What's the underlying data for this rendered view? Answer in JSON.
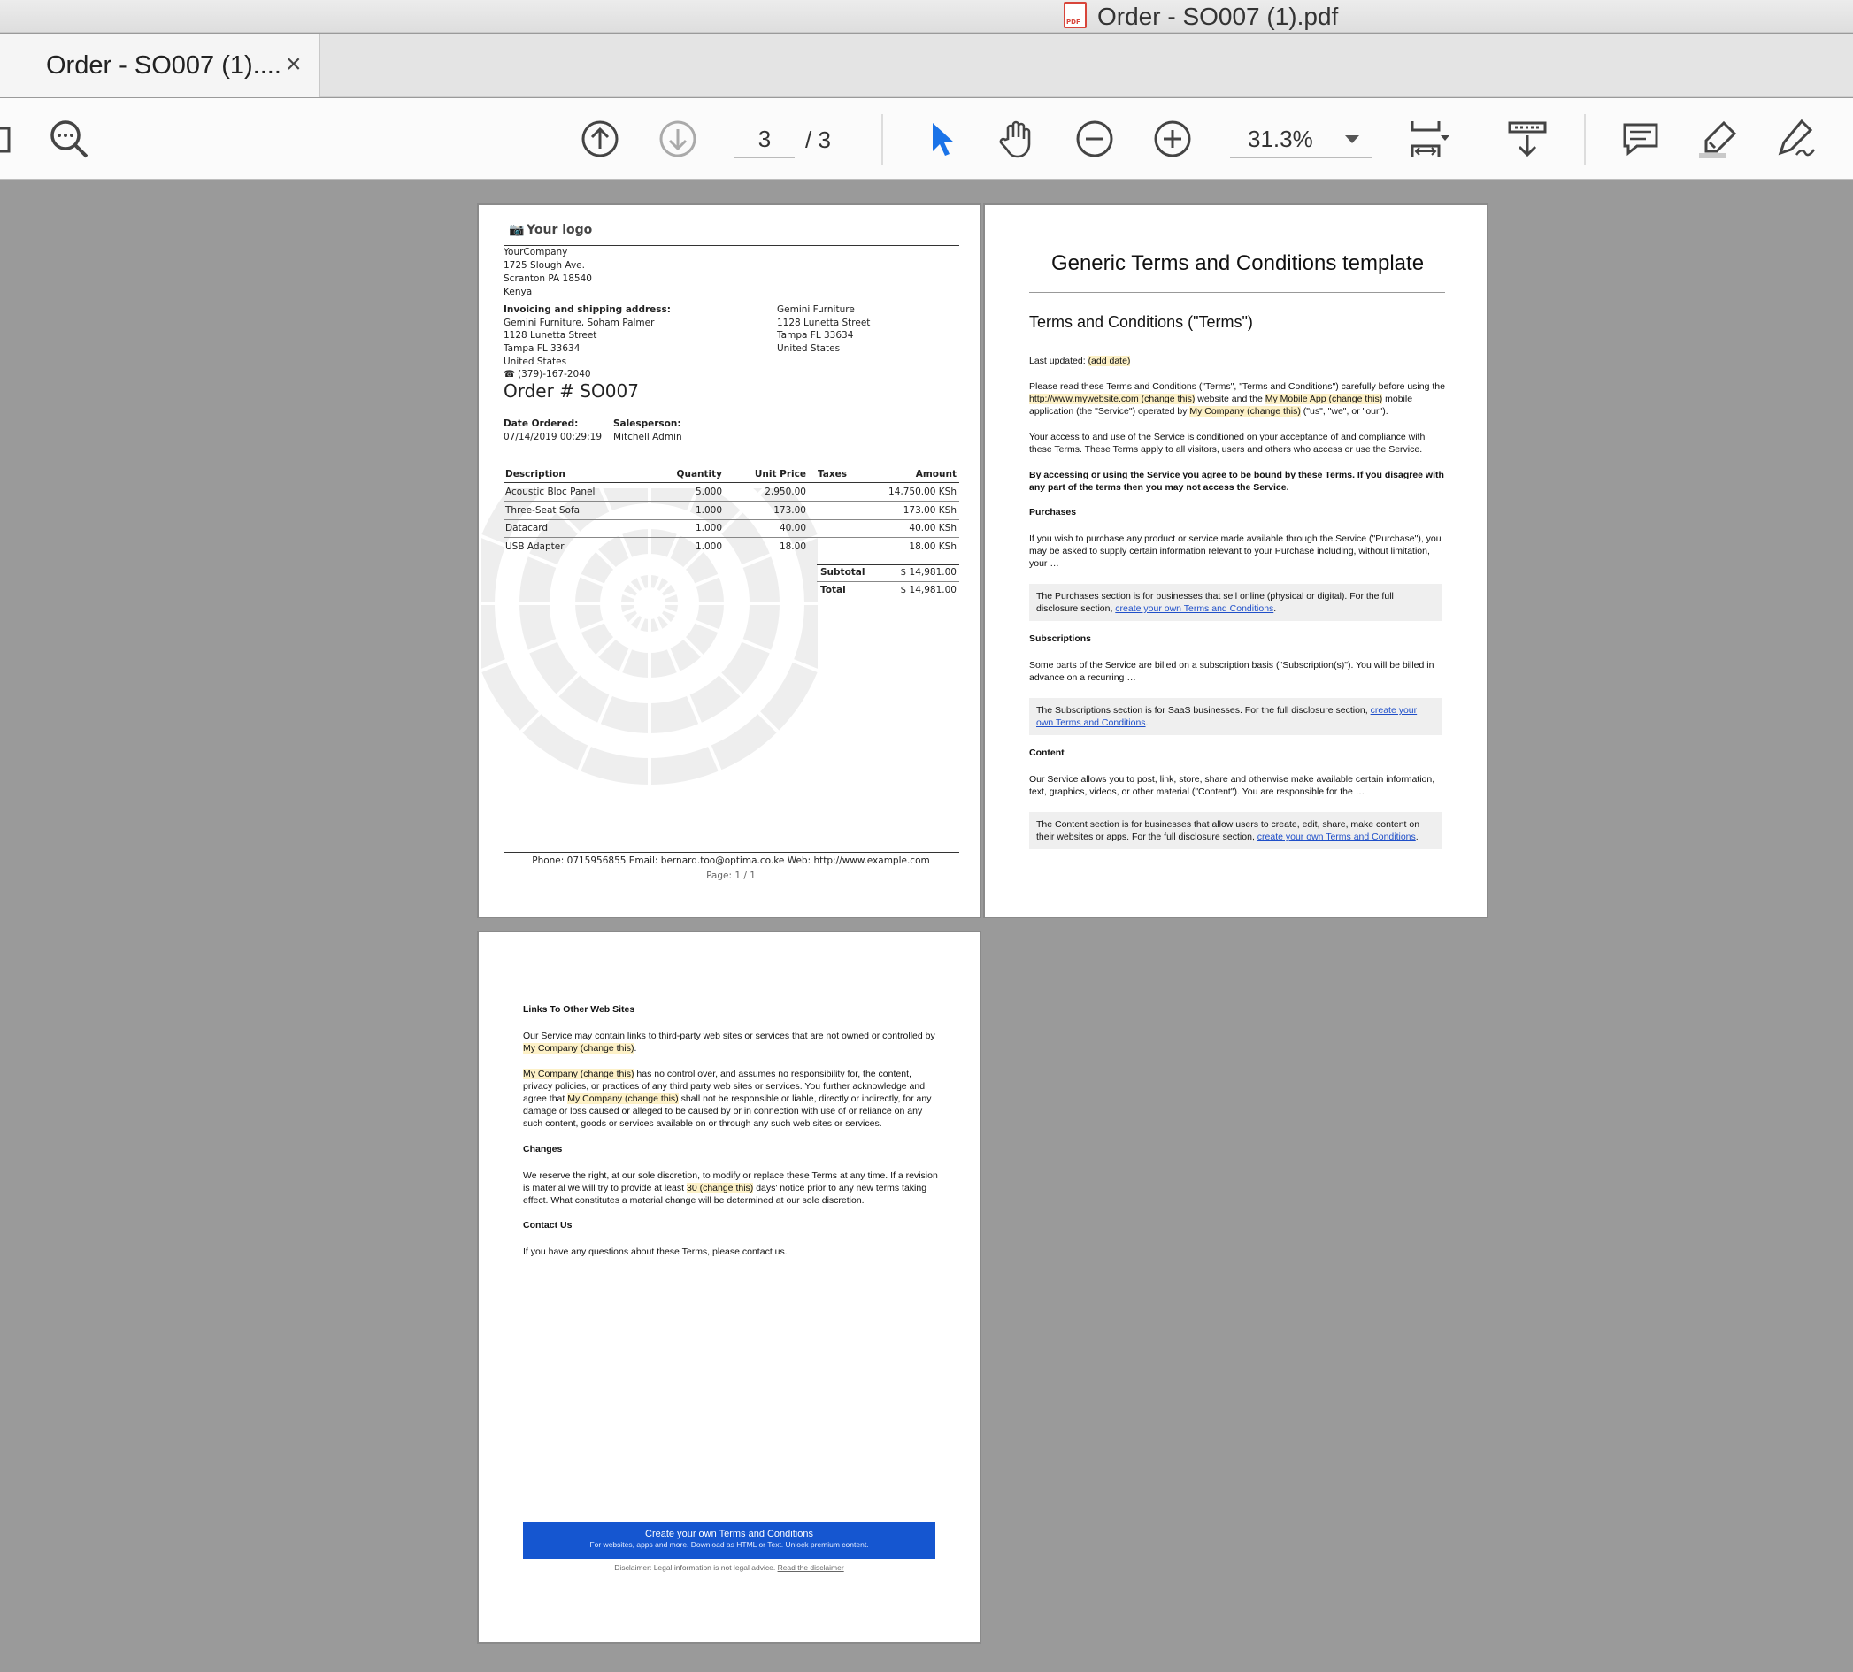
{
  "window": {
    "title": "Order - SO007 (1).pdf"
  },
  "tab": {
    "label": "Order - SO007 (1)....",
    "close": "×"
  },
  "toolbar": {
    "page_current": "3",
    "page_total": "/ 3",
    "zoom": "31.3%"
  },
  "icons": [
    "sidebar-toggle-icon",
    "search-icon",
    "page-up-icon",
    "page-down-icon",
    "select-cursor-icon",
    "hand-icon",
    "zoom-out-icon",
    "zoom-in-icon",
    "fit-page-icon",
    "scroll-mode-icon",
    "comment-icon",
    "highlight-icon",
    "sign-icon"
  ],
  "colors": {
    "accent": "#1a73e8",
    "cta_blue": "#1556d0",
    "highlight": "#fdf1c7"
  },
  "order": {
    "logo": "Your logo",
    "company": [
      "YourCompany",
      "1725 Slough Ave.",
      "Scranton PA 18540",
      "Kenya"
    ],
    "address_label": "Invoicing and shipping address:",
    "address": [
      "Gemini Furniture, Soham Palmer",
      "1128 Lunetta Street",
      "Tampa FL 33634",
      "United States",
      "(379)-167-2040"
    ],
    "ship_to": [
      "Gemini Furniture",
      "1128 Lunetta Street",
      "Tampa FL 33634",
      "United States"
    ],
    "title": "Order # SO007",
    "date_label": "Date Ordered:",
    "date_value": "07/14/2019 00:29:19",
    "salesperson_label": "Salesperson:",
    "salesperson_value": "Mitchell Admin",
    "columns": [
      "Description",
      "Quantity",
      "Unit Price",
      "Taxes",
      "Amount"
    ],
    "rows": [
      [
        "Acoustic Bloc Panel",
        "5.000",
        "2,950.00",
        "",
        "14,750.00 KSh"
      ],
      [
        "Three-Seat Sofa",
        "1.000",
        "173.00",
        "",
        "173.00 KSh"
      ],
      [
        "Datacard",
        "1.000",
        "40.00",
        "",
        "40.00 KSh"
      ],
      [
        "USB Adapter",
        "1.000",
        "18.00",
        "",
        "18.00 KSh"
      ]
    ],
    "subtotal_label": "Subtotal",
    "subtotal_value": "$ 14,981.00",
    "total_label": "Total",
    "total_value": "$ 14,981.00",
    "footer": "Phone: 0715956855   Email: bernard.too@optima.co.ke   Web: http://www.example.com",
    "page": "Page: 1 / 1"
  },
  "terms": {
    "title": "Generic Terms and Conditions template",
    "subtitle": "Terms and Conditions (\"Terms\")",
    "last_updated": "Last updated: ",
    "last_updated_hl": "(add date)",
    "p1": [
      "Please read these Terms and Conditions (\"Terms\", \"Terms and Conditions\") carefully before using",
      "the ",
      "http://www.mywebsite.com (change this)",
      " website and the ",
      "My Mobile App (change this)",
      " mobile",
      "application (the \"Service\") operated by ",
      "My Company (change this)",
      " (\"us\", \"we\", or \"our\")."
    ],
    "p2": "Your access to and use of the Service is conditioned on your acceptance of and compliance with these Terms. These Terms apply to all visitors, users and others who access or use the Service.",
    "p3": "By accessing or using the Service you agree to be bound by these Terms. If you disagree with any part of the terms then you may not access the Service.",
    "h_purchases": "Purchases",
    "p_purchases": "If you wish to purchase any product or service made available through the Service (\"Purchase\"), you may be asked to supply certain information relevant to your Purchase including, without limitation, your …",
    "note_purchases": "The Purchases section is for businesses that sell online (physical or digital). For the full disclosure section, ",
    "link": "create your own Terms and Conditions",
    "h_subscriptions": "Subscriptions",
    "p_subscriptions": "Some parts of the Service are billed on a subscription basis (\"Subscription(s)\"). You will be billed in advance on a recurring …",
    "note_subscriptions": "The Subscriptions section is for SaaS businesses. For the full disclosure section, ",
    "h_content": "Content",
    "p_content": "Our Service allows you to post, link, store, share and otherwise make available certain information, text, graphics, videos, or other material (\"Content\"). You are responsible for the …",
    "note_content": "The Content section is for businesses that allow users to create, edit, share, make content on their websites or apps. For the full disclosure section, "
  },
  "terms2": {
    "h_links": "Links To Other Web Sites",
    "p_links1a": "Our Service may contain links to third-party web sites or services that are not owned or controlled by ",
    "hl_company": "My Company (change this)",
    "p_links2b": " has no control over, and assumes no responsibility for, the content, privacy policies, or practices of any third party web sites or services. You further acknowledge and agree that ",
    "p_links2c": " shall not be responsible or liable, directly or indirectly, for any damage or loss caused or alleged to be caused by or in connection with use of or reliance on any such content, goods or services available on or through any such web sites or services.",
    "h_changes": "Changes",
    "p_changes_a": "We reserve the right, at our sole discretion, to modify or replace these Terms at any time. If a revision is material we will try to provide at least ",
    "hl_days": "30 (change this)",
    "p_changes_b": " days' notice prior to any new terms taking effect. What constitutes a material change will be determined at our sole discretion.",
    "h_contact": "Contact Us",
    "p_contact": "If you have any questions about these Terms, please contact us.",
    "cta_title": "Create your own Terms and Conditions",
    "cta_sub": "For websites, apps and more. Download as HTML or Text. Unlock premium content.",
    "disclaimer": "Disclaimer: Legal information is not legal advice. ",
    "disclaimer_link": "Read the disclaimer"
  }
}
